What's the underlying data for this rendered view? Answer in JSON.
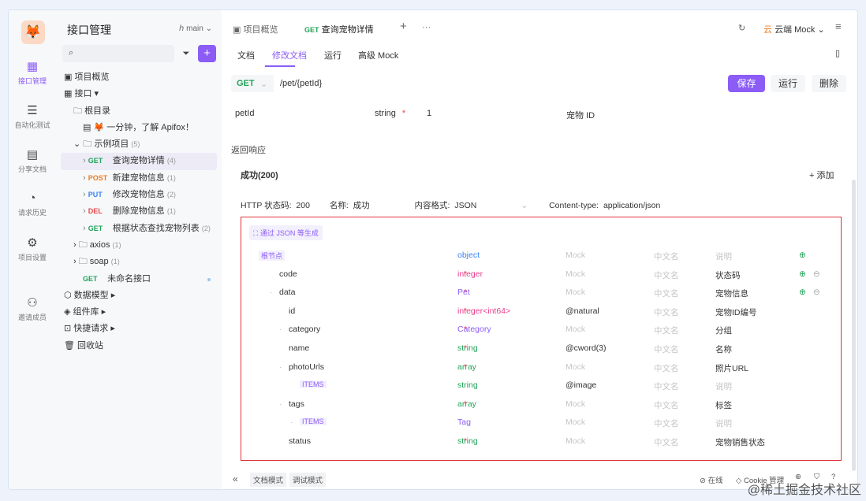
{
  "rail": {
    "items": [
      {
        "label": "接口管理",
        "icon": "api-icon"
      },
      {
        "label": "自动化测试",
        "icon": "automation-icon"
      },
      {
        "label": "分享文档",
        "icon": "share-doc-icon"
      },
      {
        "label": "请求历史",
        "icon": "history-icon"
      },
      {
        "label": "项目设置",
        "icon": "settings-icon"
      },
      {
        "label": "邀请成员",
        "icon": "invite-icon"
      }
    ]
  },
  "sidebar": {
    "title": "接口管理",
    "branch": "main",
    "overview": "项目概览",
    "api": "接口",
    "root": "根目录",
    "intro": "🦊 一分钟，了解 Apifox！",
    "folder": "示例项目",
    "folder_count": "(5)",
    "endpoints": [
      {
        "method": "GET",
        "name": "查询宠物详情",
        "count": "(4)"
      },
      {
        "method": "POST",
        "name": "新建宠物信息",
        "count": "(1)"
      },
      {
        "method": "PUT",
        "name": "修改宠物信息",
        "count": "(2)"
      },
      {
        "method": "DEL",
        "name": "删除宠物信息",
        "count": "(1)"
      },
      {
        "method": "GET",
        "name": "根据状态查找宠物列表",
        "count": "(2)"
      }
    ],
    "folders": [
      {
        "name": "axios",
        "count": "(1)"
      },
      {
        "name": "soap",
        "count": "(1)"
      }
    ],
    "unnamed": {
      "method": "GET",
      "name": "未命名接口"
    },
    "bottom": [
      "数据模型",
      "组件库",
      "快捷请求",
      "回收站"
    ]
  },
  "tabs": {
    "overview": "项目概览",
    "active_method": "GET",
    "active": "查询宠物详情",
    "env": "云端 Mock"
  },
  "subtabs": [
    "文档",
    "修改文档",
    "运行",
    "高级 Mock"
  ],
  "url": {
    "method": "GET",
    "path": "/pet/{petId}",
    "save": "保存",
    "run": "运行",
    "delete": "删除"
  },
  "param": {
    "name": "petId",
    "type": "string",
    "value": "1",
    "desc": "宠物 ID"
  },
  "response": {
    "section": "返回响应",
    "name": "成功(200)",
    "add": "+ 添加",
    "status_label": "HTTP 状态码:",
    "status": "200",
    "name_label": "名称:",
    "name_value": "成功",
    "format_label": "内容格式:",
    "format": "JSON",
    "ctype_label": "Content-type:",
    "ctype": "application/json",
    "gen": "通过 JSON 等生成"
  },
  "schema": [
    {
      "name": "根节点",
      "type": "object",
      "mock": "Mock",
      "cn": "中文名",
      "desc": "说明",
      "req": false,
      "lvl": 0,
      "tc": "#3b82f6",
      "root": true,
      "acts": 1
    },
    {
      "name": "code",
      "type": "integer",
      "mock": "Mock",
      "cn": "中文名",
      "desc": "状态码",
      "req": true,
      "lvl": 1,
      "tc": "#e83e8c",
      "acts": 2
    },
    {
      "name": "data",
      "type": "Pet",
      "mock": "Mock",
      "cn": "中文名",
      "desc": "宠物信息",
      "req": true,
      "lvl": 1,
      "tc": "#8b5cf6",
      "acts": 2,
      "exp": true
    },
    {
      "name": "id",
      "type": "integer<int64>",
      "mock": "@natural",
      "cn": "中文名",
      "desc": "宠物ID编号",
      "req": true,
      "lvl": 2,
      "tc": "#e83e8c"
    },
    {
      "name": "category",
      "type": "Category",
      "mock": "Mock",
      "cn": "中文名",
      "desc": "分组",
      "req": true,
      "lvl": 2,
      "tc": "#8b5cf6",
      "exp": true
    },
    {
      "name": "name",
      "type": "string",
      "mock": "@cword(3)",
      "cn": "中文名",
      "desc": "名称",
      "req": true,
      "lvl": 2,
      "tc": "#22a35a"
    },
    {
      "name": "photoUrls",
      "type": "array",
      "mock": "Mock",
      "cn": "中文名",
      "desc": "照片URL",
      "req": true,
      "lvl": 2,
      "tc": "#22a35a",
      "exp": true
    },
    {
      "name": "ITEMS",
      "type": "string",
      "mock": "@image",
      "cn": "中文名",
      "desc": "说明",
      "req": false,
      "lvl": 3,
      "tc": "#22a35a",
      "items": true
    },
    {
      "name": "tags",
      "type": "array",
      "mock": "Mock",
      "cn": "中文名",
      "desc": "标签",
      "req": true,
      "lvl": 2,
      "tc": "#22a35a",
      "exp": true
    },
    {
      "name": "ITEMS",
      "type": "Tag",
      "mock": "Mock",
      "cn": "中文名",
      "desc": "说明",
      "req": false,
      "lvl": 3,
      "tc": "#8b5cf6",
      "items": true,
      "exp": true
    },
    {
      "name": "status",
      "type": "string",
      "mock": "Mock",
      "cn": "中文名",
      "desc": "宠物销售状态",
      "req": true,
      "lvl": 2,
      "tc": "#22a35a"
    }
  ],
  "footer": {
    "doc_mode": "文档模式",
    "debug_mode": "调试模式",
    "online": "在线",
    "cookie": "Cookie 管理"
  },
  "watermark": "@稀土掘金技术社区"
}
